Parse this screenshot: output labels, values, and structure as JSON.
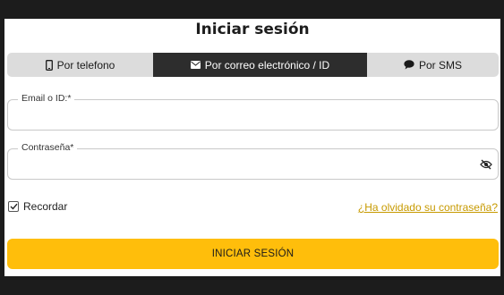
{
  "form": {
    "title": "Iniciar sesión",
    "tabs": [
      {
        "label": "Por telefono",
        "icon": "phone-icon"
      },
      {
        "label": "Por correo electrónico / ID",
        "icon": "envelope-icon",
        "active": true
      },
      {
        "label": "Por SMS",
        "icon": "chat-bubble-icon"
      }
    ],
    "email_label": "Email o ID:*",
    "email_value": "",
    "password_label": "Contraseña*",
    "password_value": "",
    "remember_label": "Recordar",
    "remember_checked": true,
    "forgot_link": "¿Ha olvidado su contraseña?",
    "submit_label": "INICIAR SESIÓN"
  },
  "colors": {
    "accent": "#ffbe0b",
    "active_tab": "#2d2d2d",
    "link": "#c79a00",
    "backdrop": "#1c1c1c"
  }
}
